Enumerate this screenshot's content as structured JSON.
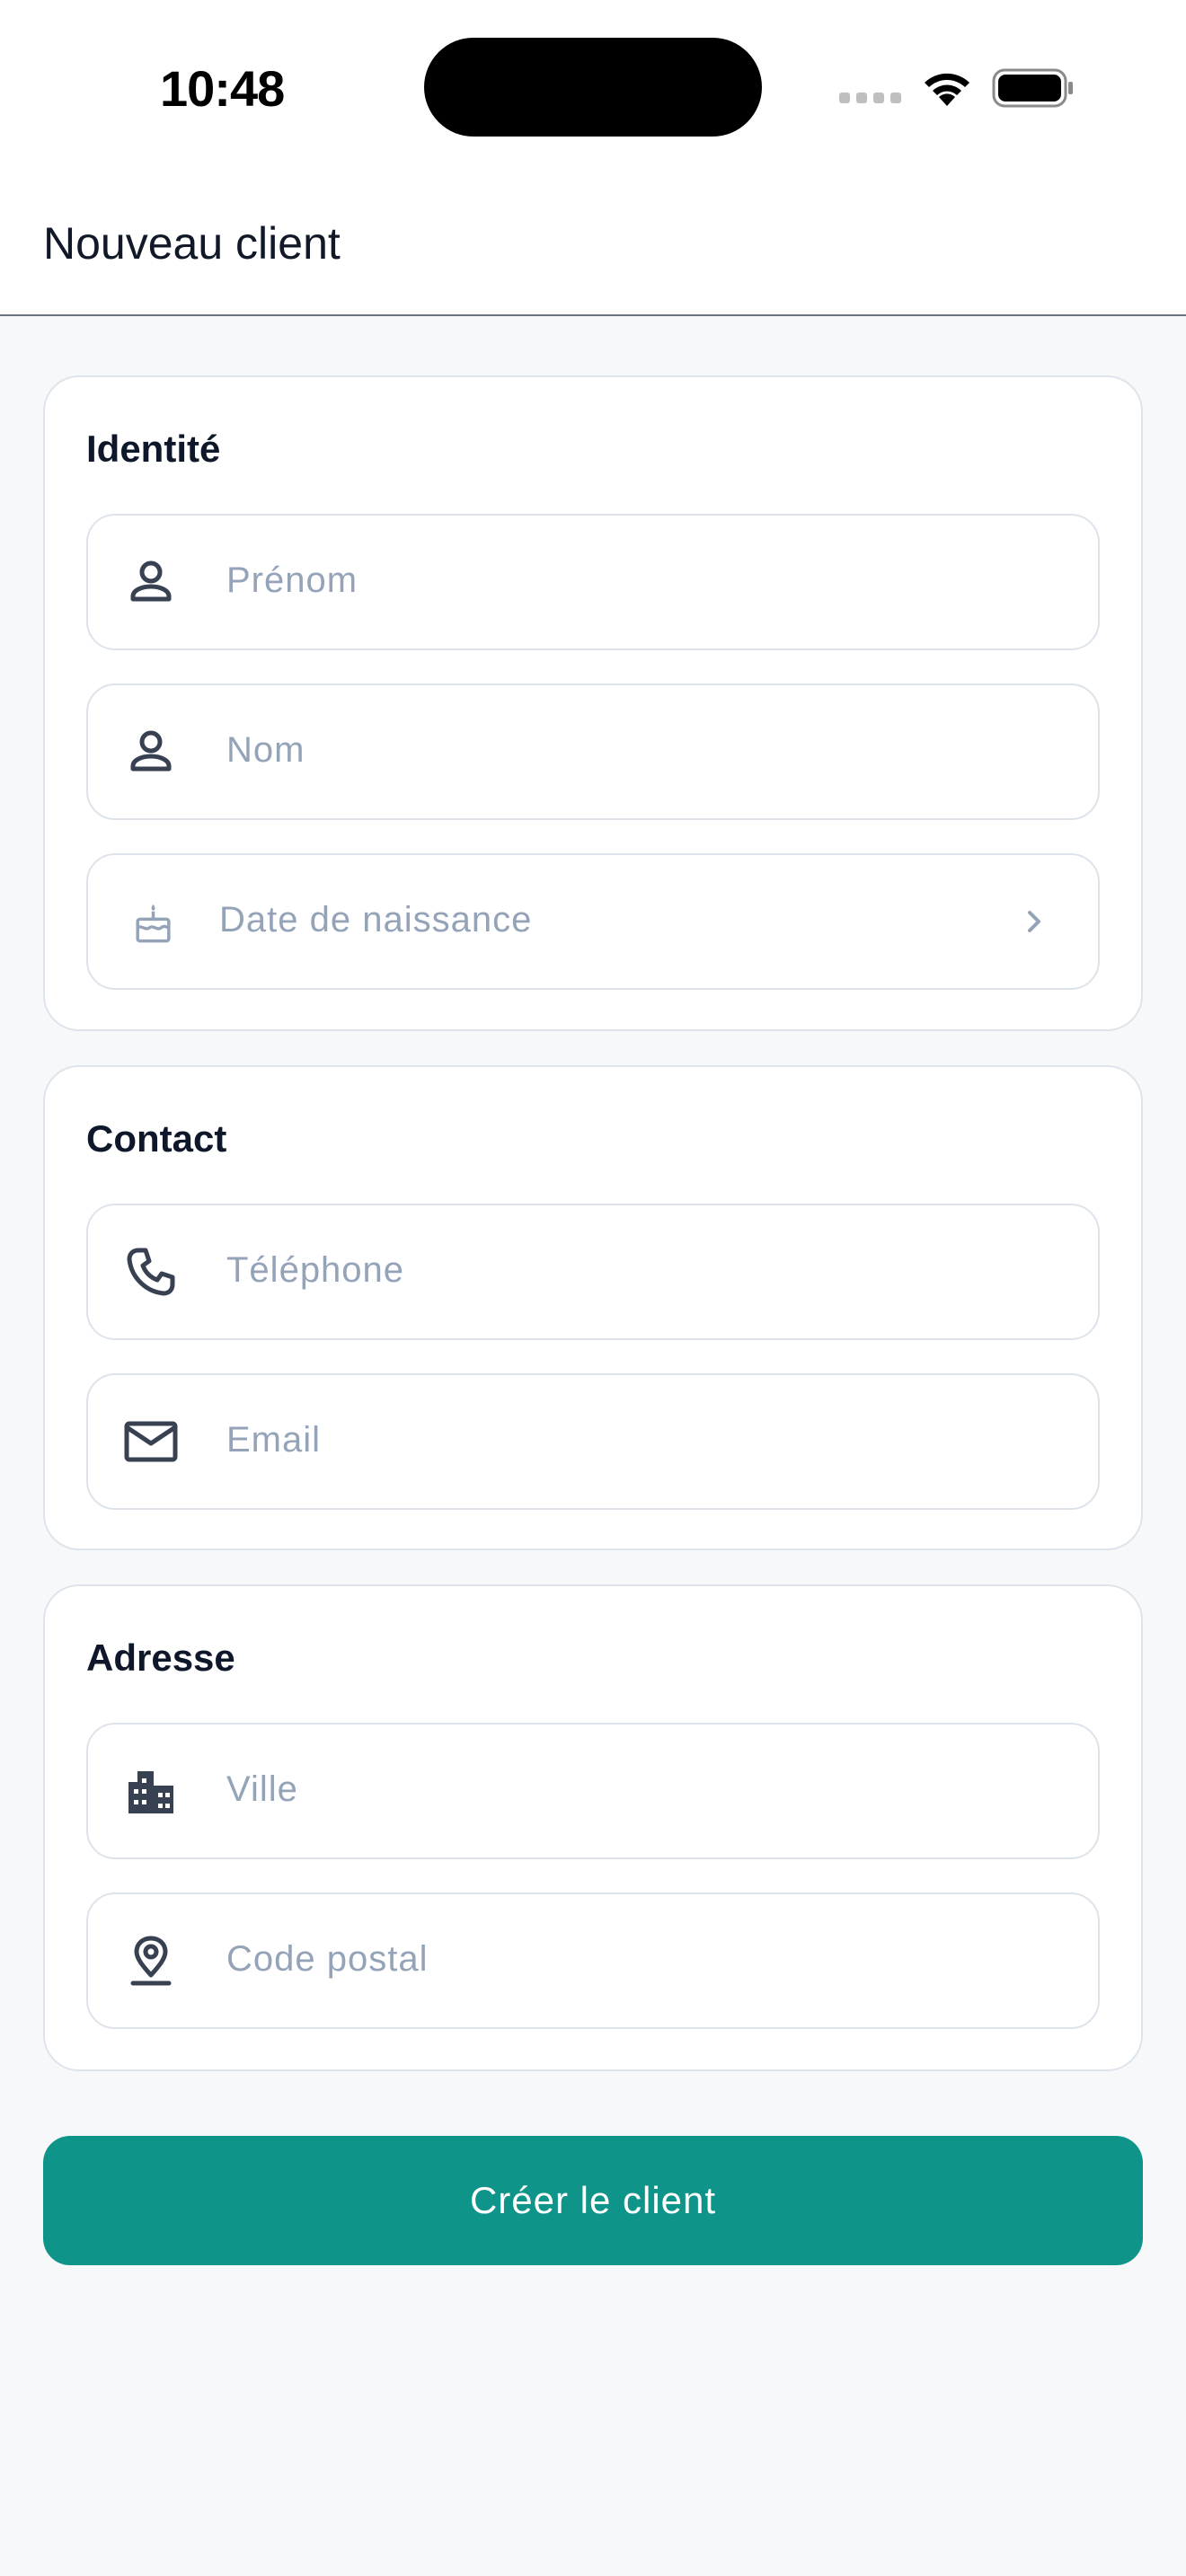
{
  "status_bar": {
    "time": "10:48"
  },
  "header": {
    "title": "Nouveau client"
  },
  "sections": {
    "identity": {
      "title": "Identité",
      "first_name_placeholder": "Prénom",
      "last_name_placeholder": "Nom",
      "birth_date_placeholder": "Date de naissance"
    },
    "contact": {
      "title": "Contact",
      "phone_placeholder": "Téléphone",
      "email_placeholder": "Email"
    },
    "address": {
      "title": "Adresse",
      "city_placeholder": "Ville",
      "postal_code_placeholder": "Code postal"
    }
  },
  "actions": {
    "create_label": "Créer le client"
  },
  "colors": {
    "accent": "#0e9488",
    "placeholder": "#94a3b8",
    "icon": "#374151",
    "border": "#dde3ea",
    "background": "#f7f8fa"
  },
  "icons": [
    "person-icon",
    "cake-icon",
    "chevron-right-icon",
    "phone-icon",
    "mail-icon",
    "building-icon",
    "location-pin-icon",
    "wifi-icon",
    "battery-icon"
  ]
}
